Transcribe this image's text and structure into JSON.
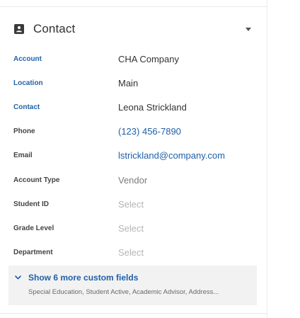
{
  "section": {
    "title": "Contact",
    "icon": "contact-card-icon",
    "toggle_icon": "caret-down-icon"
  },
  "fields": [
    {
      "label": "Account",
      "value": "CHA Company",
      "label_style": "link",
      "value_style": "normal"
    },
    {
      "label": "Location",
      "value": "Main",
      "label_style": "link",
      "value_style": "normal"
    },
    {
      "label": "Contact",
      "value": "Leona Strickland",
      "label_style": "link",
      "value_style": "normal"
    },
    {
      "label": "Phone",
      "value": "(123) 456-7890",
      "label_style": "plain",
      "value_style": "link"
    },
    {
      "label": "Email",
      "value": "lstrickland@company.com",
      "label_style": "plain",
      "value_style": "link"
    },
    {
      "label": "Account Type",
      "value": "Vendor",
      "label_style": "plain",
      "value_style": "muted"
    },
    {
      "label": "Student ID",
      "value": "Select",
      "label_style": "plain",
      "value_style": "placeholder"
    },
    {
      "label": "Grade Level",
      "value": "Select",
      "label_style": "plain",
      "value_style": "placeholder"
    },
    {
      "label": "Department",
      "value": "Select",
      "label_style": "plain",
      "value_style": "placeholder"
    }
  ],
  "more_fields": {
    "title": "Show 6 more custom fields",
    "subtitle": "Special Education, Student Active, Academic Advisor, Address...",
    "icon": "chevron-down-icon"
  },
  "colors": {
    "link": "#1f5fa8",
    "label": "#444444",
    "placeholder": "#b5b5b5",
    "more_bg": "#f2f2f2"
  }
}
